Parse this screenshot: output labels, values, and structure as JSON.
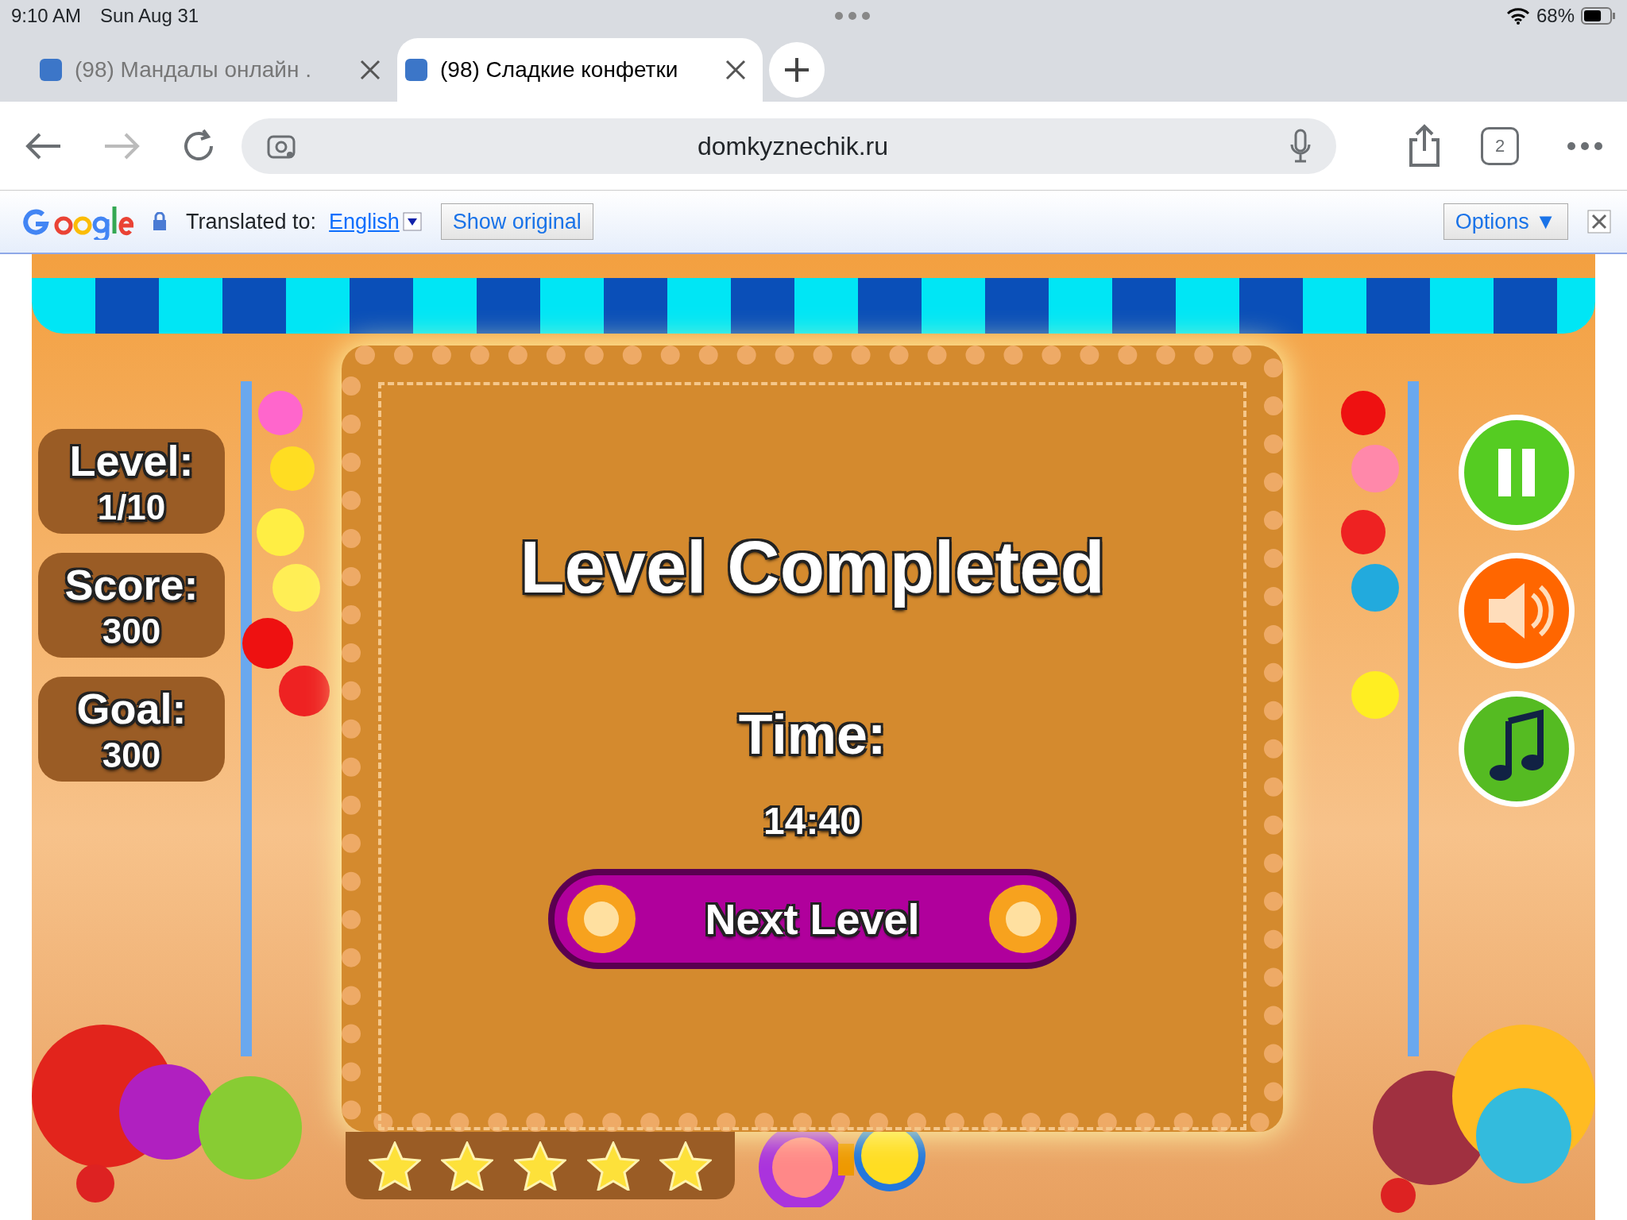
{
  "status_bar": {
    "time": "9:10 AM",
    "date": "Sun Aug 31",
    "battery": "68%"
  },
  "tabs": [
    {
      "title": "(98) Мандалы онлайн .",
      "selected": false
    },
    {
      "title": "(98) Сладкие конфетки",
      "selected": true
    }
  ],
  "address_bar": {
    "url": "domkyznechik.ru"
  },
  "tab_count": "2",
  "translate_bar": {
    "label": "Translated to:",
    "language": "English",
    "show_original": "Show original",
    "options": "Options ▼"
  },
  "game": {
    "hud": [
      {
        "label": "Level:",
        "value": "1/10"
      },
      {
        "label": "Score:",
        "value": "300"
      },
      {
        "label": "Goal:",
        "value": "300"
      }
    ],
    "dialog": {
      "title": "Level Completed",
      "time_label": "Time:",
      "time_value": "14:40",
      "button": "Next Level"
    },
    "rating": {
      "stars": 5
    }
  }
}
